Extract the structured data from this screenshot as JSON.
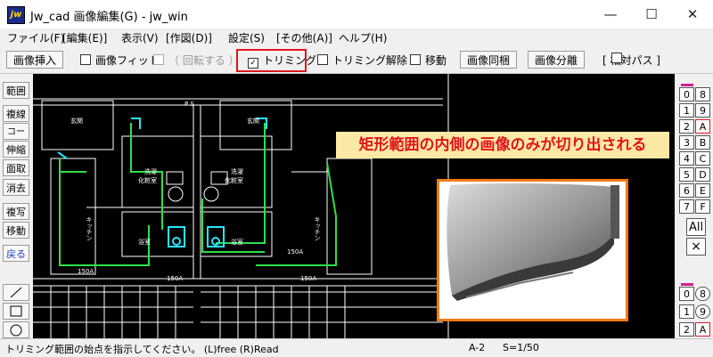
{
  "window": {
    "title": "Jw_cad 画像編集(G) - jw_win",
    "icon_text": "jw",
    "minimize_icon": "minimize-icon",
    "maximize_icon": "maximize-icon",
    "close_icon": "close-icon"
  },
  "menu": [
    "ファイル(F)",
    "[編集(E)]",
    "表示(V)",
    "[作図(D)]",
    "設定(S)",
    "[その他(A)]",
    "ヘルプ(H)"
  ],
  "toolbar": {
    "insert_image": "画像挿入",
    "image_fit": "画像フィット",
    "rotate": "（ 回転する ）",
    "trimming": "トリミング",
    "trimming_checked": true,
    "trimming_release": "トリミング解除",
    "move": "移動",
    "image_bundle": "画像同梱",
    "image_separate": "画像分離",
    "relative_path": "[ 相対パス ]",
    "highlight_color": "#e0161b"
  },
  "left_tools": [
    "範囲",
    "複線",
    "コーナー",
    "伸縮",
    "面取",
    "消去",
    "複写",
    "移動",
    "戻る"
  ],
  "left_shapes": [
    "line-tool-icon",
    "rectangle-tool-icon",
    "circle-tool-icon"
  ],
  "right_layers": {
    "group_top_left": [
      "0",
      "1",
      "2",
      "3",
      "4",
      "5",
      "6",
      "7"
    ],
    "group_top_right": [
      "8",
      "9",
      "A",
      "B",
      "C",
      "D",
      "E",
      "F"
    ],
    "all_label": "All",
    "x_label": "×",
    "group_bottom_left": [
      "0",
      "1",
      "2"
    ],
    "group_bottom_right": [
      "8",
      "9",
      "A"
    ]
  },
  "annotation": {
    "text": "矩形範囲の内側の画像のみが切り出される",
    "text_color": "#e0161b",
    "bg_color": "#fde9a6",
    "box_border_color": "#f07a1a"
  },
  "drawing_labels": [
    "玄関",
    "玄関",
    "洗濯",
    "化粧室",
    "洗濯",
    "化粧室",
    "浴室",
    "浴室",
    "キッチン",
    "キッチン",
    "150A",
    "150A",
    "150A",
    "150A",
    "P S"
  ],
  "status": {
    "message": "トリミング範囲の始点を指示してください。 (L)free (R)Read",
    "layer": "A-2",
    "scale": "S=1/50"
  }
}
